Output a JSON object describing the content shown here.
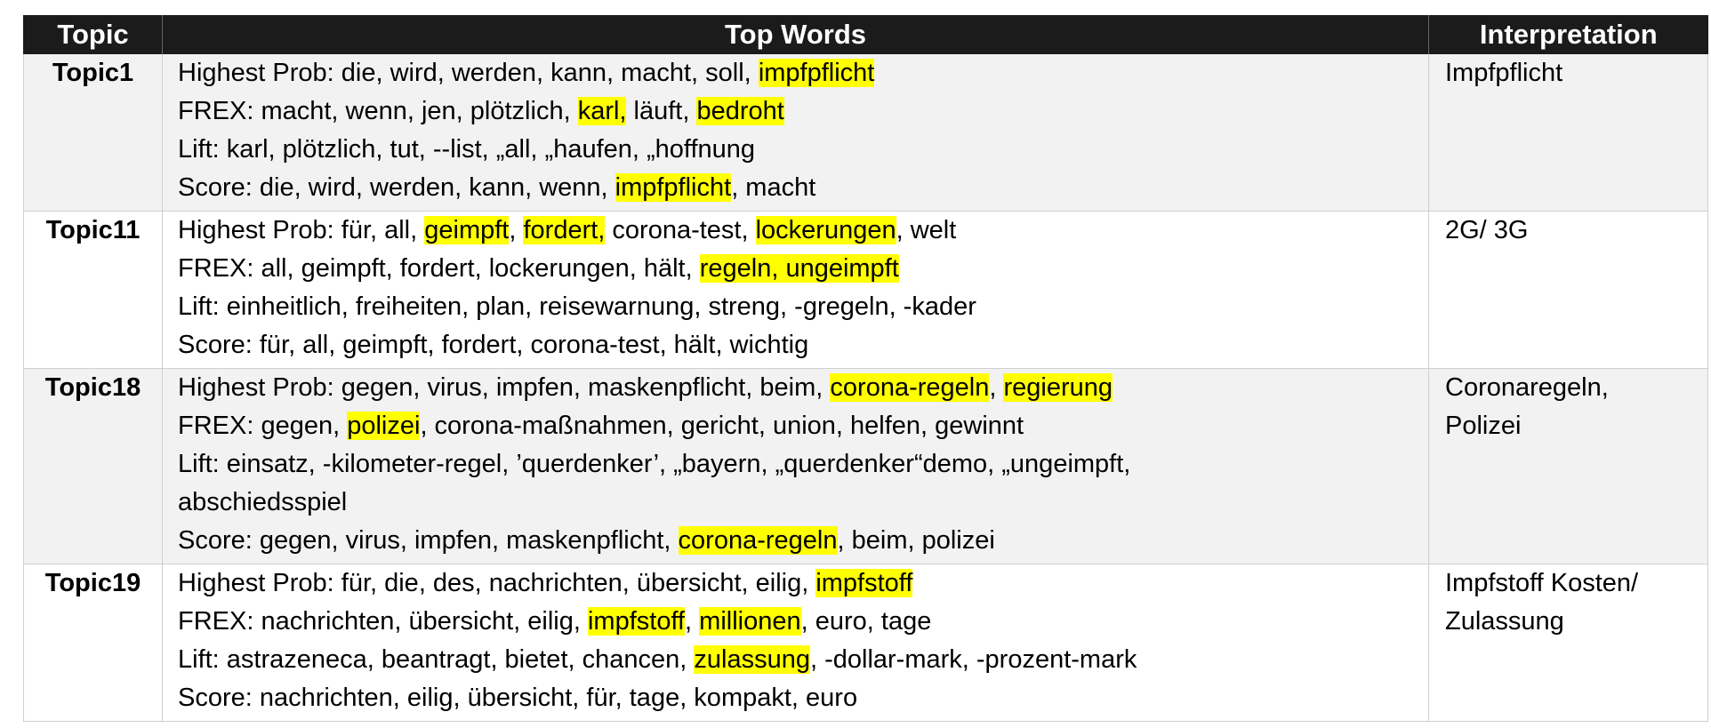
{
  "colors": {
    "header_bg": "#1b1b1b",
    "header_text": "#ffffff",
    "shaded_row": "#f2f2f2",
    "highlight": "#ffff00",
    "grid_line": "#cfcfcf"
  },
  "header": {
    "topic": "Topic",
    "top_words": "Top Words",
    "interpretation": "Interpretation"
  },
  "rows": [
    {
      "topic": "Topic1",
      "lines": [
        [
          {
            "t": "Highest Prob: die, wird, werden, kann, macht, soll, "
          },
          {
            "t": "impfpflicht",
            "hl": true
          }
        ],
        [
          {
            "t": "FREX: macht, wenn, jen, plötzlich, "
          },
          {
            "t": "karl,",
            "hl": true
          },
          {
            "t": " läuft, "
          },
          {
            "t": "bedroht",
            "hl": true
          }
        ],
        [
          {
            "t": "Lift: karl, plötzlich, tut, --list, „all, „haufen, „hoffnung"
          }
        ],
        [
          {
            "t": "Score: die, wird, werden, kann, wenn, "
          },
          {
            "t": "impfpflicht",
            "hl": true
          },
          {
            "t": ", macht"
          }
        ]
      ],
      "interpretation": [
        "Impfpflicht"
      ]
    },
    {
      "topic": "Topic11",
      "lines": [
        [
          {
            "t": "Highest Prob: für, all, "
          },
          {
            "t": "geimpft",
            "hl": true
          },
          {
            "t": ", "
          },
          {
            "t": "fordert,",
            "hl": true
          },
          {
            "t": " corona-test, "
          },
          {
            "t": "lockerungen",
            "hl": true
          },
          {
            "t": ", welt"
          }
        ],
        [
          {
            "t": "FREX: all, geimpft, fordert, lockerungen, hält, "
          },
          {
            "t": "regeln, ungeimpft",
            "hl": true
          }
        ],
        [
          {
            "t": "Lift: einheitlich, freiheiten, plan, reisewarnung, streng, -gregeln, -kader"
          }
        ],
        [
          {
            "t": "Score: für, all, geimpft, fordert, corona-test, hält, wichtig"
          }
        ]
      ],
      "interpretation": [
        "2G/ 3G"
      ]
    },
    {
      "topic": "Topic18",
      "lines": [
        [
          {
            "t": "Highest Prob: gegen, virus, impfen, maskenpflicht, beim, "
          },
          {
            "t": "corona-regeln",
            "hl": true
          },
          {
            "t": ", "
          },
          {
            "t": "regierung",
            "hl": true
          }
        ],
        [
          {
            "t": "FREX: gegen, "
          },
          {
            "t": "polizei",
            "hl": true
          },
          {
            "t": ", corona-maßnahmen, gericht, union, helfen, gewinnt"
          }
        ],
        [
          {
            "t": "Lift: einsatz, -kilometer-regel, ’querdenker’, „bayern, „querdenker“demo, „ungeimpft,"
          }
        ],
        [
          {
            "t": "abschiedsspiel"
          }
        ],
        [
          {
            "t": "Score: gegen, virus, impfen, maskenpflicht, "
          },
          {
            "t": "corona-regeln",
            "hl": true
          },
          {
            "t": ", beim, polizei"
          }
        ]
      ],
      "interpretation": [
        "Coronaregeln,",
        "Polizei"
      ]
    },
    {
      "topic": "Topic19",
      "lines": [
        [
          {
            "t": "Highest Prob: für, die, des, nachrichten, übersicht, eilig, "
          },
          {
            "t": "impfstoff",
            "hl": true
          }
        ],
        [
          {
            "t": "FREX: nachrichten, übersicht, eilig, "
          },
          {
            "t": "impfstoff",
            "hl": true
          },
          {
            "t": ", "
          },
          {
            "t": "millionen",
            "hl": true
          },
          {
            "t": ", euro, tage"
          }
        ],
        [
          {
            "t": "Lift: astrazeneca, beantragt, bietet, chancen, "
          },
          {
            "t": "zulassung",
            "hl": true
          },
          {
            "t": ", -dollar-mark, -prozent-mark"
          }
        ],
        [
          {
            "t": "Score: nachrichten, eilig, übersicht, für, tage, kompakt, euro"
          }
        ]
      ],
      "interpretation": [
        "Impfstoff Kosten/",
        "Zulassung"
      ]
    }
  ]
}
